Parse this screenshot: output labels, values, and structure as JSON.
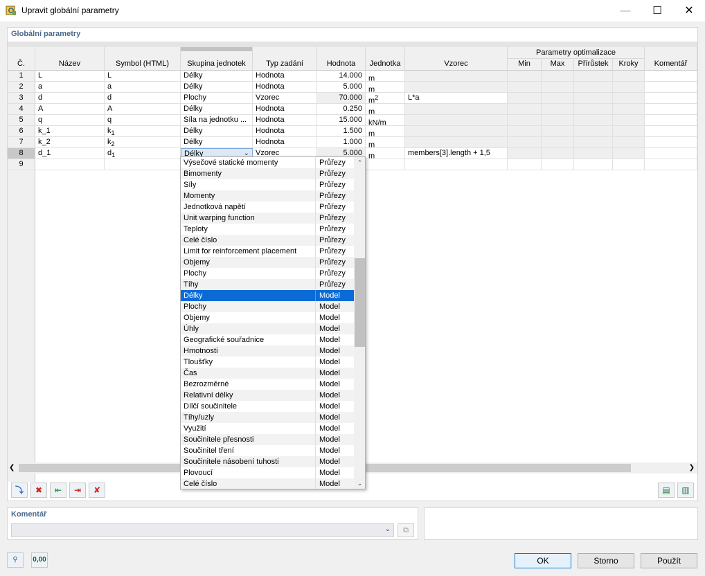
{
  "window": {
    "title": "Upravit globální parametry",
    "min_glyph": "—",
    "max_glyph": "☐",
    "close_glyph": "✕"
  },
  "panel": {
    "title": "Globální parametry"
  },
  "table": {
    "headers": {
      "no": "Č.",
      "name": "Název",
      "symbol": "Symbol (HTML)",
      "unit_group": "Skupina jednotek",
      "input_type": "Typ zadání",
      "value": "Hodnota",
      "unit": "Jednotka",
      "formula": "Vzorec",
      "opt_group": "Parametry optimalizace",
      "min": "Min",
      "max": "Max",
      "increment": "Přírůstek",
      "steps": "Kroky",
      "comment": "Komentář"
    },
    "rows": [
      {
        "no": "1",
        "name": "L",
        "symbol": "L",
        "sub": "",
        "group": "Délky",
        "type": "Hodnota",
        "value": "14.000",
        "unit": "m",
        "sup": "",
        "formula": ""
      },
      {
        "no": "2",
        "name": "a",
        "symbol": "a",
        "sub": "",
        "group": "Délky",
        "type": "Hodnota",
        "value": "5.000",
        "unit": "m",
        "sup": "",
        "formula": ""
      },
      {
        "no": "3",
        "name": "d",
        "symbol": "d",
        "sub": "",
        "group": "Plochy",
        "type": "Vzorec",
        "value": "70.000",
        "unit": "m",
        "sup": "2",
        "formula": "L*a"
      },
      {
        "no": "4",
        "name": "A",
        "symbol": "A",
        "sub": "",
        "group": "Délky",
        "type": "Hodnota",
        "value": "0.250",
        "unit": "m",
        "sup": "",
        "formula": ""
      },
      {
        "no": "5",
        "name": "q",
        "symbol": "q",
        "sub": "",
        "group": "Síla na jednotku ...",
        "type": "Hodnota",
        "value": "15.000",
        "unit": "kN/m",
        "sup": "",
        "formula": ""
      },
      {
        "no": "6",
        "name": "k_1",
        "symbol": "k",
        "sub": "1",
        "group": "Délky",
        "type": "Hodnota",
        "value": "1.500",
        "unit": "m",
        "sup": "",
        "formula": ""
      },
      {
        "no": "7",
        "name": "k_2",
        "symbol": "k",
        "sub": "2",
        "group": "Délky",
        "type": "Hodnota",
        "value": "1.000",
        "unit": "m",
        "sup": "",
        "formula": ""
      },
      {
        "no": "8",
        "name": "d_1",
        "symbol": "d",
        "sub": "1",
        "group": "Délky",
        "type": "Vzorec",
        "value": "5.000",
        "unit": "m",
        "sup": "",
        "formula": "members[3].length + 1,5"
      },
      {
        "no": "9",
        "name": "",
        "symbol": "",
        "sub": "",
        "group": "",
        "type": "",
        "value": "",
        "unit": "",
        "sup": "",
        "formula": ""
      }
    ]
  },
  "dropdown": {
    "selected_index": 12,
    "items": [
      {
        "name": "Výsečové statické momenty",
        "group": "Průřezy"
      },
      {
        "name": "Bimomenty",
        "group": "Průřezy"
      },
      {
        "name": "Síly",
        "group": "Průřezy"
      },
      {
        "name": "Momenty",
        "group": "Průřezy"
      },
      {
        "name": "Jednotková napětí",
        "group": "Průřezy"
      },
      {
        "name": "Unit warping function",
        "group": "Průřezy"
      },
      {
        "name": "Teploty",
        "group": "Průřezy"
      },
      {
        "name": "Celé číslo",
        "group": "Průřezy"
      },
      {
        "name": "Limit for reinforcement placement",
        "group": "Průřezy"
      },
      {
        "name": "Objemy",
        "group": "Průřezy"
      },
      {
        "name": "Plochy",
        "group": "Průřezy"
      },
      {
        "name": "Tíhy",
        "group": "Průřezy"
      },
      {
        "name": "Délky",
        "group": "Model"
      },
      {
        "name": "Plochy",
        "group": "Model"
      },
      {
        "name": "Objemy",
        "group": "Model"
      },
      {
        "name": "Úhly",
        "group": "Model"
      },
      {
        "name": "Geografické souřadnice",
        "group": "Model"
      },
      {
        "name": "Hmotnosti",
        "group": "Model"
      },
      {
        "name": "Tloušťky",
        "group": "Model"
      },
      {
        "name": "Čas",
        "group": "Model"
      },
      {
        "name": "Bezrozměrné",
        "group": "Model"
      },
      {
        "name": "Relativní délky",
        "group": "Model"
      },
      {
        "name": "Dílčí součinitele",
        "group": "Model"
      },
      {
        "name": "Tíhy/uzly",
        "group": "Model"
      },
      {
        "name": "Využití",
        "group": "Model"
      },
      {
        "name": "Součinitele přesnosti",
        "group": "Model"
      },
      {
        "name": "Součinitel tření",
        "group": "Model"
      },
      {
        "name": "Součinitele násobení tuhosti",
        "group": "Model"
      },
      {
        "name": "Plovoucí",
        "group": "Model"
      },
      {
        "name": "Celé číslo",
        "group": "Model"
      }
    ]
  },
  "comment": {
    "title": "Komentář",
    "value": ""
  },
  "buttons": {
    "ok": "OK",
    "cancel": "Storno",
    "apply": "Použít"
  },
  "status_icon_label": "0,00",
  "colors": {
    "selection": "#0a6bd6",
    "header_text": "#4d6a8c"
  },
  "icons": [
    "app-icon",
    "insert-row-icon",
    "delete-row-icon",
    "move-left-icon",
    "move-right-icon",
    "clear-icon",
    "export-icon",
    "import-icon",
    "help-icon",
    "units-icon",
    "copy-icon"
  ]
}
